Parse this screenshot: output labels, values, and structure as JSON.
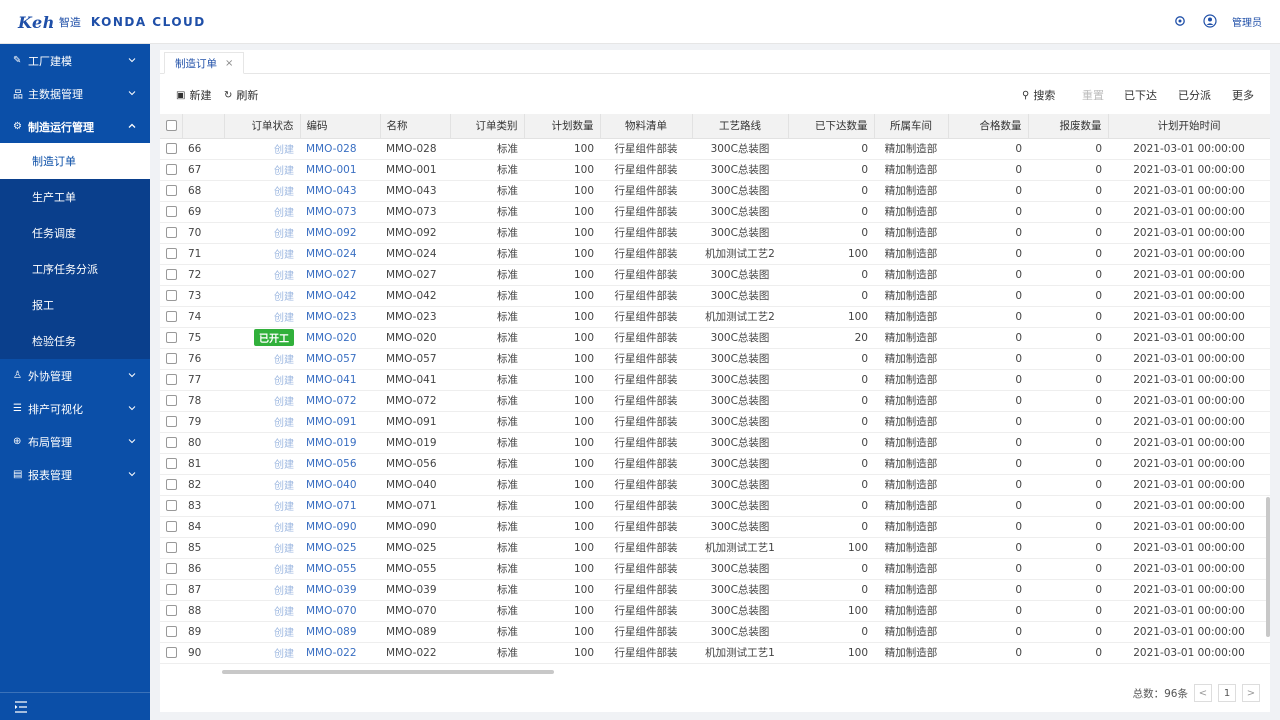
{
  "header": {
    "brand": "Keh",
    "brand_sub": "智造",
    "cloud_name": "KONDA CLOUD",
    "user": "管理员"
  },
  "sidebar": {
    "groups": [
      {
        "label": "工厂建模",
        "icon": "pencil-icon"
      },
      {
        "label": "主数据管理",
        "icon": "hierarchy-icon"
      },
      {
        "label": "制造运行管理",
        "icon": "gear-icon",
        "open": true
      },
      {
        "label": "外协管理",
        "icon": "people-icon"
      },
      {
        "label": "排产可视化",
        "icon": "list-icon"
      },
      {
        "label": "布局管理",
        "icon": "layout-icon"
      },
      {
        "label": "报表管理",
        "icon": "report-icon"
      }
    ],
    "subitems": [
      "制造订单",
      "生产工单",
      "任务调度",
      "工序任务分派",
      "报工",
      "检验任务"
    ]
  },
  "tabs": [
    {
      "label": "制造订单",
      "close": "×"
    }
  ],
  "toolbar": {
    "new": "新建",
    "refresh": "刷新",
    "search": "搜索",
    "reset": "重置",
    "issued": "已下达",
    "assigned": "已分派",
    "more": "更多"
  },
  "table": {
    "headers": [
      "",
      "",
      "订单状态",
      "编码",
      "名称",
      "订单类别",
      "计划数量",
      "物料清单",
      "工艺路线",
      "已下达数量",
      "所属车间",
      "合格数量",
      "报废数量",
      "计划开始时间"
    ],
    "rows": [
      {
        "no": "66",
        "status": "创建",
        "code": "MMO-028",
        "name": "MMO-028",
        "type": "标准",
        "qty": "100",
        "bom": "行星组件部装",
        "route": "300C总装图",
        "issued": "0",
        "shop": "精加制造部",
        "good": "0",
        "scrap": "0",
        "start": "2021-03-01 00:00:00"
      },
      {
        "no": "67",
        "status": "创建",
        "code": "MMO-001",
        "name": "MMO-001",
        "type": "标准",
        "qty": "100",
        "bom": "行星组件部装",
        "route": "300C总装图",
        "issued": "0",
        "shop": "精加制造部",
        "good": "0",
        "scrap": "0",
        "start": "2021-03-01 00:00:00"
      },
      {
        "no": "68",
        "status": "创建",
        "code": "MMO-043",
        "name": "MMO-043",
        "type": "标准",
        "qty": "100",
        "bom": "行星组件部装",
        "route": "300C总装图",
        "issued": "0",
        "shop": "精加制造部",
        "good": "0",
        "scrap": "0",
        "start": "2021-03-01 00:00:00"
      },
      {
        "no": "69",
        "status": "创建",
        "code": "MMO-073",
        "name": "MMO-073",
        "type": "标准",
        "qty": "100",
        "bom": "行星组件部装",
        "route": "300C总装图",
        "issued": "0",
        "shop": "精加制造部",
        "good": "0",
        "scrap": "0",
        "start": "2021-03-01 00:00:00"
      },
      {
        "no": "70",
        "status": "创建",
        "code": "MMO-092",
        "name": "MMO-092",
        "type": "标准",
        "qty": "100",
        "bom": "行星组件部装",
        "route": "300C总装图",
        "issued": "0",
        "shop": "精加制造部",
        "good": "0",
        "scrap": "0",
        "start": "2021-03-01 00:00:00"
      },
      {
        "no": "71",
        "status": "创建",
        "code": "MMO-024",
        "name": "MMO-024",
        "type": "标准",
        "qty": "100",
        "bom": "行星组件部装",
        "route": "机加测试工艺2",
        "issued": "100",
        "shop": "精加制造部",
        "good": "0",
        "scrap": "0",
        "start": "2021-03-01 00:00:00"
      },
      {
        "no": "72",
        "status": "创建",
        "code": "MMO-027",
        "name": "MMO-027",
        "type": "标准",
        "qty": "100",
        "bom": "行星组件部装",
        "route": "300C总装图",
        "issued": "0",
        "shop": "精加制造部",
        "good": "0",
        "scrap": "0",
        "start": "2021-03-01 00:00:00"
      },
      {
        "no": "73",
        "status": "创建",
        "code": "MMO-042",
        "name": "MMO-042",
        "type": "标准",
        "qty": "100",
        "bom": "行星组件部装",
        "route": "300C总装图",
        "issued": "0",
        "shop": "精加制造部",
        "good": "0",
        "scrap": "0",
        "start": "2021-03-01 00:00:00"
      },
      {
        "no": "74",
        "status": "创建",
        "code": "MMO-023",
        "name": "MMO-023",
        "type": "标准",
        "qty": "100",
        "bom": "行星组件部装",
        "route": "机加测试工艺2",
        "issued": "100",
        "shop": "精加制造部",
        "good": "0",
        "scrap": "0",
        "start": "2021-03-01 00:00:00"
      },
      {
        "no": "75",
        "status": "已开工",
        "badge": true,
        "code": "MMO-020",
        "name": "MMO-020",
        "type": "标准",
        "qty": "100",
        "bom": "行星组件部装",
        "route": "300C总装图",
        "issued": "20",
        "shop": "精加制造部",
        "good": "0",
        "scrap": "0",
        "start": "2021-03-01 00:00:00"
      },
      {
        "no": "76",
        "status": "创建",
        "code": "MMO-057",
        "name": "MMO-057",
        "type": "标准",
        "qty": "100",
        "bom": "行星组件部装",
        "route": "300C总装图",
        "issued": "0",
        "shop": "精加制造部",
        "good": "0",
        "scrap": "0",
        "start": "2021-03-01 00:00:00"
      },
      {
        "no": "77",
        "status": "创建",
        "code": "MMO-041",
        "name": "MMO-041",
        "type": "标准",
        "qty": "100",
        "bom": "行星组件部装",
        "route": "300C总装图",
        "issued": "0",
        "shop": "精加制造部",
        "good": "0",
        "scrap": "0",
        "start": "2021-03-01 00:00:00"
      },
      {
        "no": "78",
        "status": "创建",
        "code": "MMO-072",
        "name": "MMO-072",
        "type": "标准",
        "qty": "100",
        "bom": "行星组件部装",
        "route": "300C总装图",
        "issued": "0",
        "shop": "精加制造部",
        "good": "0",
        "scrap": "0",
        "start": "2021-03-01 00:00:00"
      },
      {
        "no": "79",
        "status": "创建",
        "code": "MMO-091",
        "name": "MMO-091",
        "type": "标准",
        "qty": "100",
        "bom": "行星组件部装",
        "route": "300C总装图",
        "issued": "0",
        "shop": "精加制造部",
        "good": "0",
        "scrap": "0",
        "start": "2021-03-01 00:00:00"
      },
      {
        "no": "80",
        "status": "创建",
        "code": "MMO-019",
        "name": "MMO-019",
        "type": "标准",
        "qty": "100",
        "bom": "行星组件部装",
        "route": "300C总装图",
        "issued": "0",
        "shop": "精加制造部",
        "good": "0",
        "scrap": "0",
        "start": "2021-03-01 00:00:00"
      },
      {
        "no": "81",
        "status": "创建",
        "code": "MMO-056",
        "name": "MMO-056",
        "type": "标准",
        "qty": "100",
        "bom": "行星组件部装",
        "route": "300C总装图",
        "issued": "0",
        "shop": "精加制造部",
        "good": "0",
        "scrap": "0",
        "start": "2021-03-01 00:00:00"
      },
      {
        "no": "82",
        "status": "创建",
        "code": "MMO-040",
        "name": "MMO-040",
        "type": "标准",
        "qty": "100",
        "bom": "行星组件部装",
        "route": "300C总装图",
        "issued": "0",
        "shop": "精加制造部",
        "good": "0",
        "scrap": "0",
        "start": "2021-03-01 00:00:00"
      },
      {
        "no": "83",
        "status": "创建",
        "code": "MMO-071",
        "name": "MMO-071",
        "type": "标准",
        "qty": "100",
        "bom": "行星组件部装",
        "route": "300C总装图",
        "issued": "0",
        "shop": "精加制造部",
        "good": "0",
        "scrap": "0",
        "start": "2021-03-01 00:00:00"
      },
      {
        "no": "84",
        "status": "创建",
        "code": "MMO-090",
        "name": "MMO-090",
        "type": "标准",
        "qty": "100",
        "bom": "行星组件部装",
        "route": "300C总装图",
        "issued": "0",
        "shop": "精加制造部",
        "good": "0",
        "scrap": "0",
        "start": "2021-03-01 00:00:00"
      },
      {
        "no": "85",
        "status": "创建",
        "code": "MMO-025",
        "name": "MMO-025",
        "type": "标准",
        "qty": "100",
        "bom": "行星组件部装",
        "route": "机加测试工艺1",
        "issued": "100",
        "shop": "精加制造部",
        "good": "0",
        "scrap": "0",
        "start": "2021-03-01 00:00:00"
      },
      {
        "no": "86",
        "status": "创建",
        "code": "MMO-055",
        "name": "MMO-055",
        "type": "标准",
        "qty": "100",
        "bom": "行星组件部装",
        "route": "300C总装图",
        "issued": "0",
        "shop": "精加制造部",
        "good": "0",
        "scrap": "0",
        "start": "2021-03-01 00:00:00"
      },
      {
        "no": "87",
        "status": "创建",
        "code": "MMO-039",
        "name": "MMO-039",
        "type": "标准",
        "qty": "100",
        "bom": "行星组件部装",
        "route": "300C总装图",
        "issued": "0",
        "shop": "精加制造部",
        "good": "0",
        "scrap": "0",
        "start": "2021-03-01 00:00:00"
      },
      {
        "no": "88",
        "status": "创建",
        "code": "MMO-070",
        "name": "MMO-070",
        "type": "标准",
        "qty": "100",
        "bom": "行星组件部装",
        "route": "300C总装图",
        "issued": "100",
        "shop": "精加制造部",
        "good": "0",
        "scrap": "0",
        "start": "2021-03-01 00:00:00"
      },
      {
        "no": "89",
        "status": "创建",
        "code": "MMO-089",
        "name": "MMO-089",
        "type": "标准",
        "qty": "100",
        "bom": "行星组件部装",
        "route": "300C总装图",
        "issued": "0",
        "shop": "精加制造部",
        "good": "0",
        "scrap": "0",
        "start": "2021-03-01 00:00:00"
      },
      {
        "no": "90",
        "status": "创建",
        "code": "MMO-022",
        "name": "MMO-022",
        "type": "标准",
        "qty": "100",
        "bom": "行星组件部装",
        "route": "机加测试工艺1",
        "issued": "100",
        "shop": "精加制造部",
        "good": "0",
        "scrap": "0",
        "start": "2021-03-01 00:00:00"
      }
    ]
  },
  "pager": {
    "total": "总数：96条",
    "page": "1",
    "prev": "<",
    "next": ">"
  },
  "colors": {
    "sidebar": "#0b4fa8",
    "accent": "#1f4fa8",
    "badge": "#31b03b"
  }
}
